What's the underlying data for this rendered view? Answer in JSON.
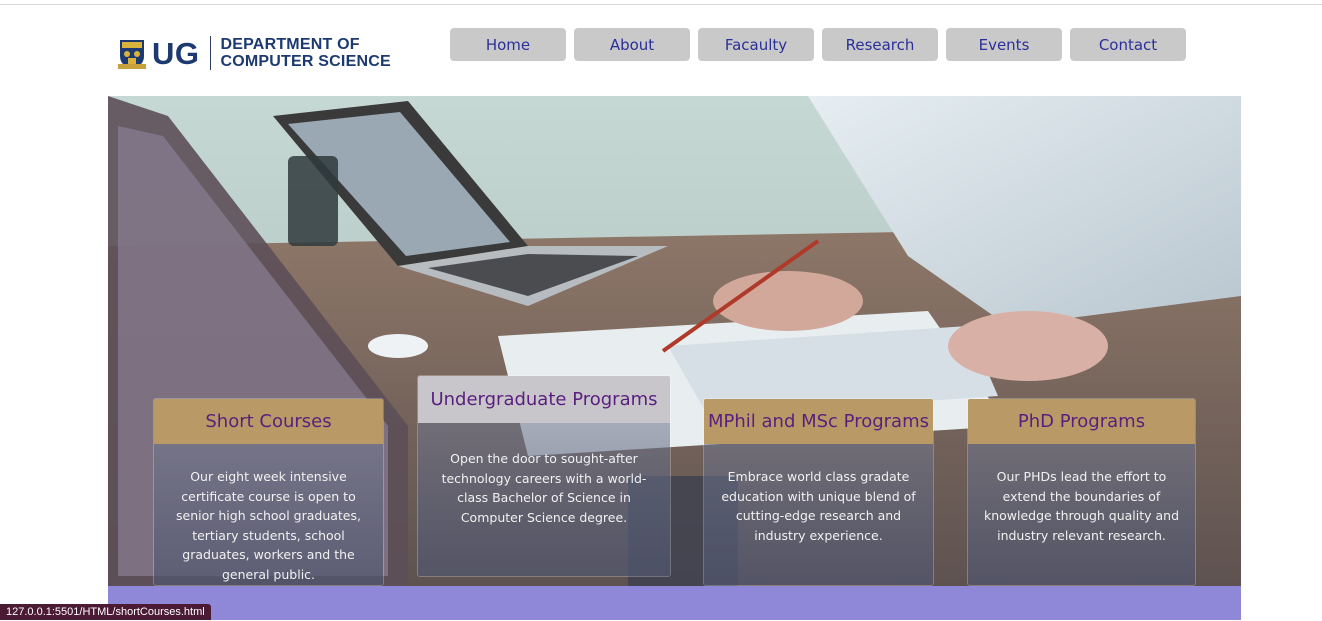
{
  "header": {
    "logo_short": "UG",
    "logo_dept_line1": "DEPARTMENT OF",
    "logo_dept_line2": "COMPUTER SCIENCE"
  },
  "nav": {
    "items": [
      "Home",
      "About",
      "Facaulty",
      "Research",
      "Events",
      "Contact"
    ]
  },
  "programs": [
    {
      "title": "Short Courses",
      "description": "Our eight week intensive certificate course is open to senior high school graduates, tertiary students, school graduates, workers and the general public."
    },
    {
      "title": "Undergraduate Programs",
      "description": "Open the door to sought-after technology careers with a world-class Bachelor of Science in Computer Science degree."
    },
    {
      "title": "MPhil and MSc Programs",
      "description": "Embrace world class gradate education with unique blend of cutting-edge research and industry experience."
    },
    {
      "title": "PhD Programs",
      "description": "Our PHDs lead the effort to extend the boundaries of knowledge through quality and industry relevant research."
    }
  ],
  "status_bar": {
    "url": "127.0.0.1:5501/HTML/shortCourses.html"
  },
  "colors": {
    "nav_bg": "#c9c9c9",
    "nav_text": "#2b2f9a",
    "card_head_gold": "#b99a66",
    "card_head_grey": "#c8c6cb",
    "card_title": "#5a1f7e",
    "footer_band": "#8f88d8",
    "logo_navy": "#1d3a70"
  }
}
